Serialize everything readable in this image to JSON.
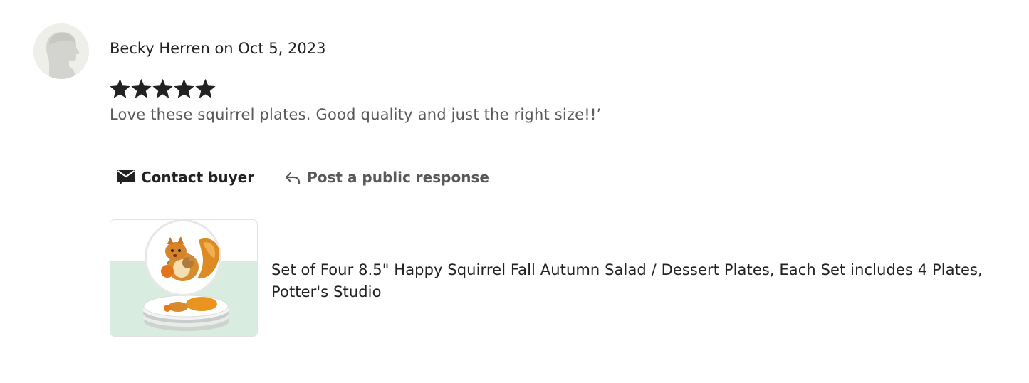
{
  "review": {
    "reviewer_name": "Becky Herren",
    "date_text": "on Oct 5, 2023",
    "rating": 5,
    "rating_max": 5,
    "text": "Love these squirrel plates. Good quality and just the right size!!’"
  },
  "actions": {
    "contact_buyer_label": "Contact buyer",
    "contact_icon": "envelope-icon",
    "post_response_label": "Post a public response",
    "post_response_icon": "reply-arrow-icon"
  },
  "product": {
    "title": "Set of Four 8.5\" Happy Squirrel Fall Autumn Salad / Dessert Plates, Each Set includes 4 Plates, Potter's Studio",
    "thumbnail_background_color": "#d8ecdf"
  },
  "colors": {
    "text_primary": "#222222",
    "text_secondary": "#595959",
    "star": "#222222"
  }
}
